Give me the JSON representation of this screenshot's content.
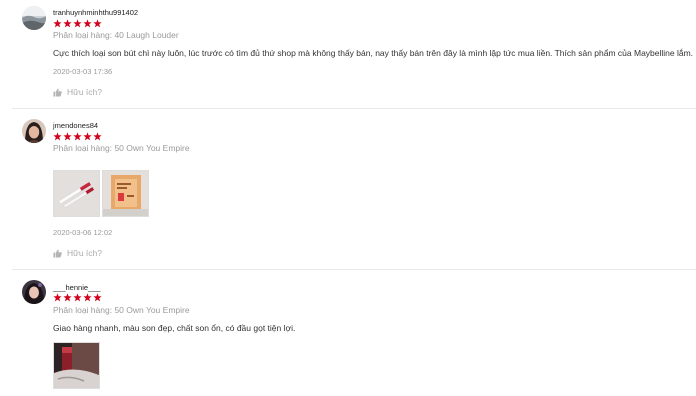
{
  "reviews": [
    {
      "username": "tranhuynhminhthu991402",
      "rating": 5,
      "variant": "Phân loại hàng: 40 Laugh Louder",
      "comment": "Cực thích loại son bút chì này luôn, lúc trước có tìm đủ thứ shop mà không thấy bán, nay thấy bán trên đây là mình lập tức mua liền. Thích sản phẩm của Maybelline lắm.",
      "timestamp": "2020-03-03 17:36",
      "helpful_label": "Hữu ích?"
    },
    {
      "username": "jmendones84",
      "rating": 5,
      "variant": "Phân loại hàng: 50 Own You Empire",
      "comment": "",
      "timestamp": "2020-03-06 12:02",
      "helpful_label": "Hữu ích?"
    },
    {
      "username": "___hennie___",
      "rating": 5,
      "variant": "Phân loại hàng: 50 Own You Empire",
      "comment": "Giao hàng nhanh, màu son đẹp, chất son ổn, có đầu gọt tiện lợi.",
      "timestamp": "",
      "helpful_label": ""
    }
  ],
  "colors": {
    "star": "#d0011b",
    "variant_text": "#9a9a9a",
    "divider": "#e9e9e9"
  },
  "icons": {
    "star": "star-icon",
    "helpful": "thumbs-up-icon"
  }
}
